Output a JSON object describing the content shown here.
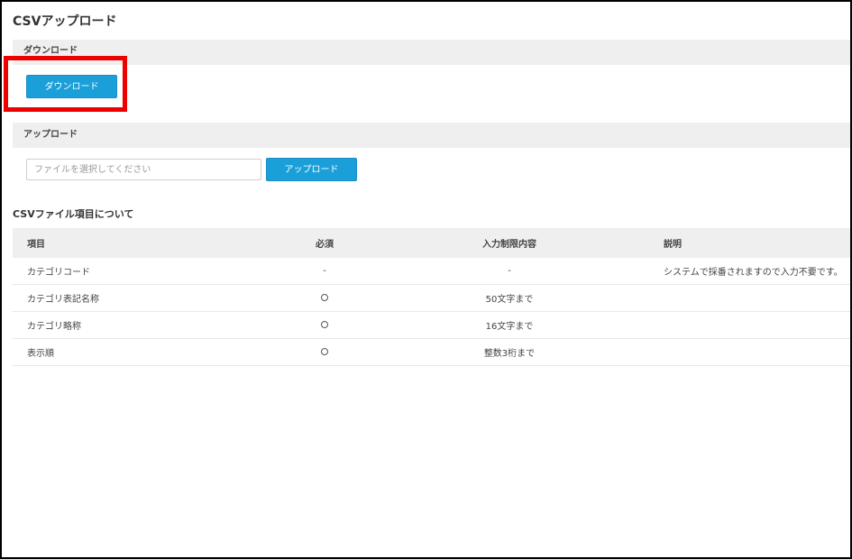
{
  "page": {
    "title": "CSVアップロード"
  },
  "download": {
    "section_label": "ダウンロード",
    "button_label": "ダウンロード"
  },
  "upload": {
    "section_label": "アップロード",
    "file_placeholder": "ファイルを選択してください",
    "button_label": "アップロード"
  },
  "fields": {
    "title": "CSVファイル項目について",
    "headers": [
      "項目",
      "必須",
      "入力制限内容",
      "説明"
    ],
    "rows": [
      [
        "カテゴリコード",
        "-",
        "-",
        "システムで採番されますので入力不要です。"
      ],
      [
        "カテゴリ表記名称",
        "○",
        "50文字まで",
        ""
      ],
      [
        "カテゴリ略称",
        "○",
        "16文字まで",
        ""
      ],
      [
        "表示順",
        "○",
        "整数3桁まで",
        ""
      ]
    ]
  },
  "colors": {
    "primary_button": "#1a9fd9",
    "highlight": "#ee0000",
    "section_bg": "#efefef"
  }
}
